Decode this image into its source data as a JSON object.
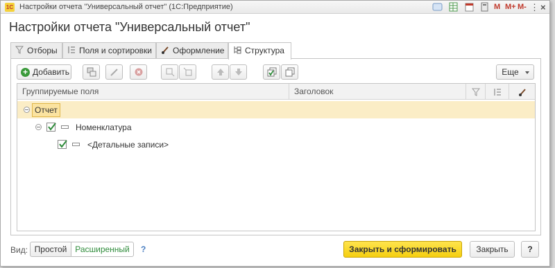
{
  "window": {
    "title": "Настройки отчета \"Универсальный отчет\"  (1С:Предприятие)",
    "logo": "1С",
    "titlebar_buttons": {
      "m": "M",
      "m_plus": "M+",
      "m_minus": "M-",
      "menu": "⋮",
      "minimize": "_",
      "maximize": "□",
      "close": "×"
    }
  },
  "page": {
    "heading": "Настройки отчета \"Универсальный отчет\""
  },
  "tabs": [
    {
      "label": "Отборы",
      "icon": "filter-icon",
      "active": false
    },
    {
      "label": "Поля и сортировки",
      "icon": "sort-fields-icon",
      "active": false
    },
    {
      "label": "Оформление",
      "icon": "brush-icon",
      "active": false
    },
    {
      "label": "Структура",
      "icon": "structure-icon",
      "active": true
    }
  ],
  "toolbar": {
    "add_label": "Добавить",
    "more_label": "Еще"
  },
  "grid": {
    "columns": {
      "fields": "Группируемые поля",
      "header": "Заголовок"
    },
    "rows": [
      {
        "label": "Отчет",
        "level": 0,
        "selected": true,
        "checkbox": false
      },
      {
        "label": "Номенклатура",
        "level": 1,
        "selected": false,
        "checkbox": true,
        "checked": true
      },
      {
        "label": "<Детальные записи>",
        "level": 2,
        "selected": false,
        "checkbox": true,
        "checked": true
      }
    ]
  },
  "footer": {
    "view_label": "Вид:",
    "mode_simple": "Простой",
    "mode_extended": "Расширенный",
    "help": "?",
    "close_and_build": "Закрыть и сформировать",
    "close": "Закрыть",
    "question": "?"
  },
  "colors": {
    "accent_yellow": "#f5cf10",
    "selection": "#fbedc6",
    "check_green": "#2e8b3a",
    "link_green": "#2e8b3a"
  }
}
